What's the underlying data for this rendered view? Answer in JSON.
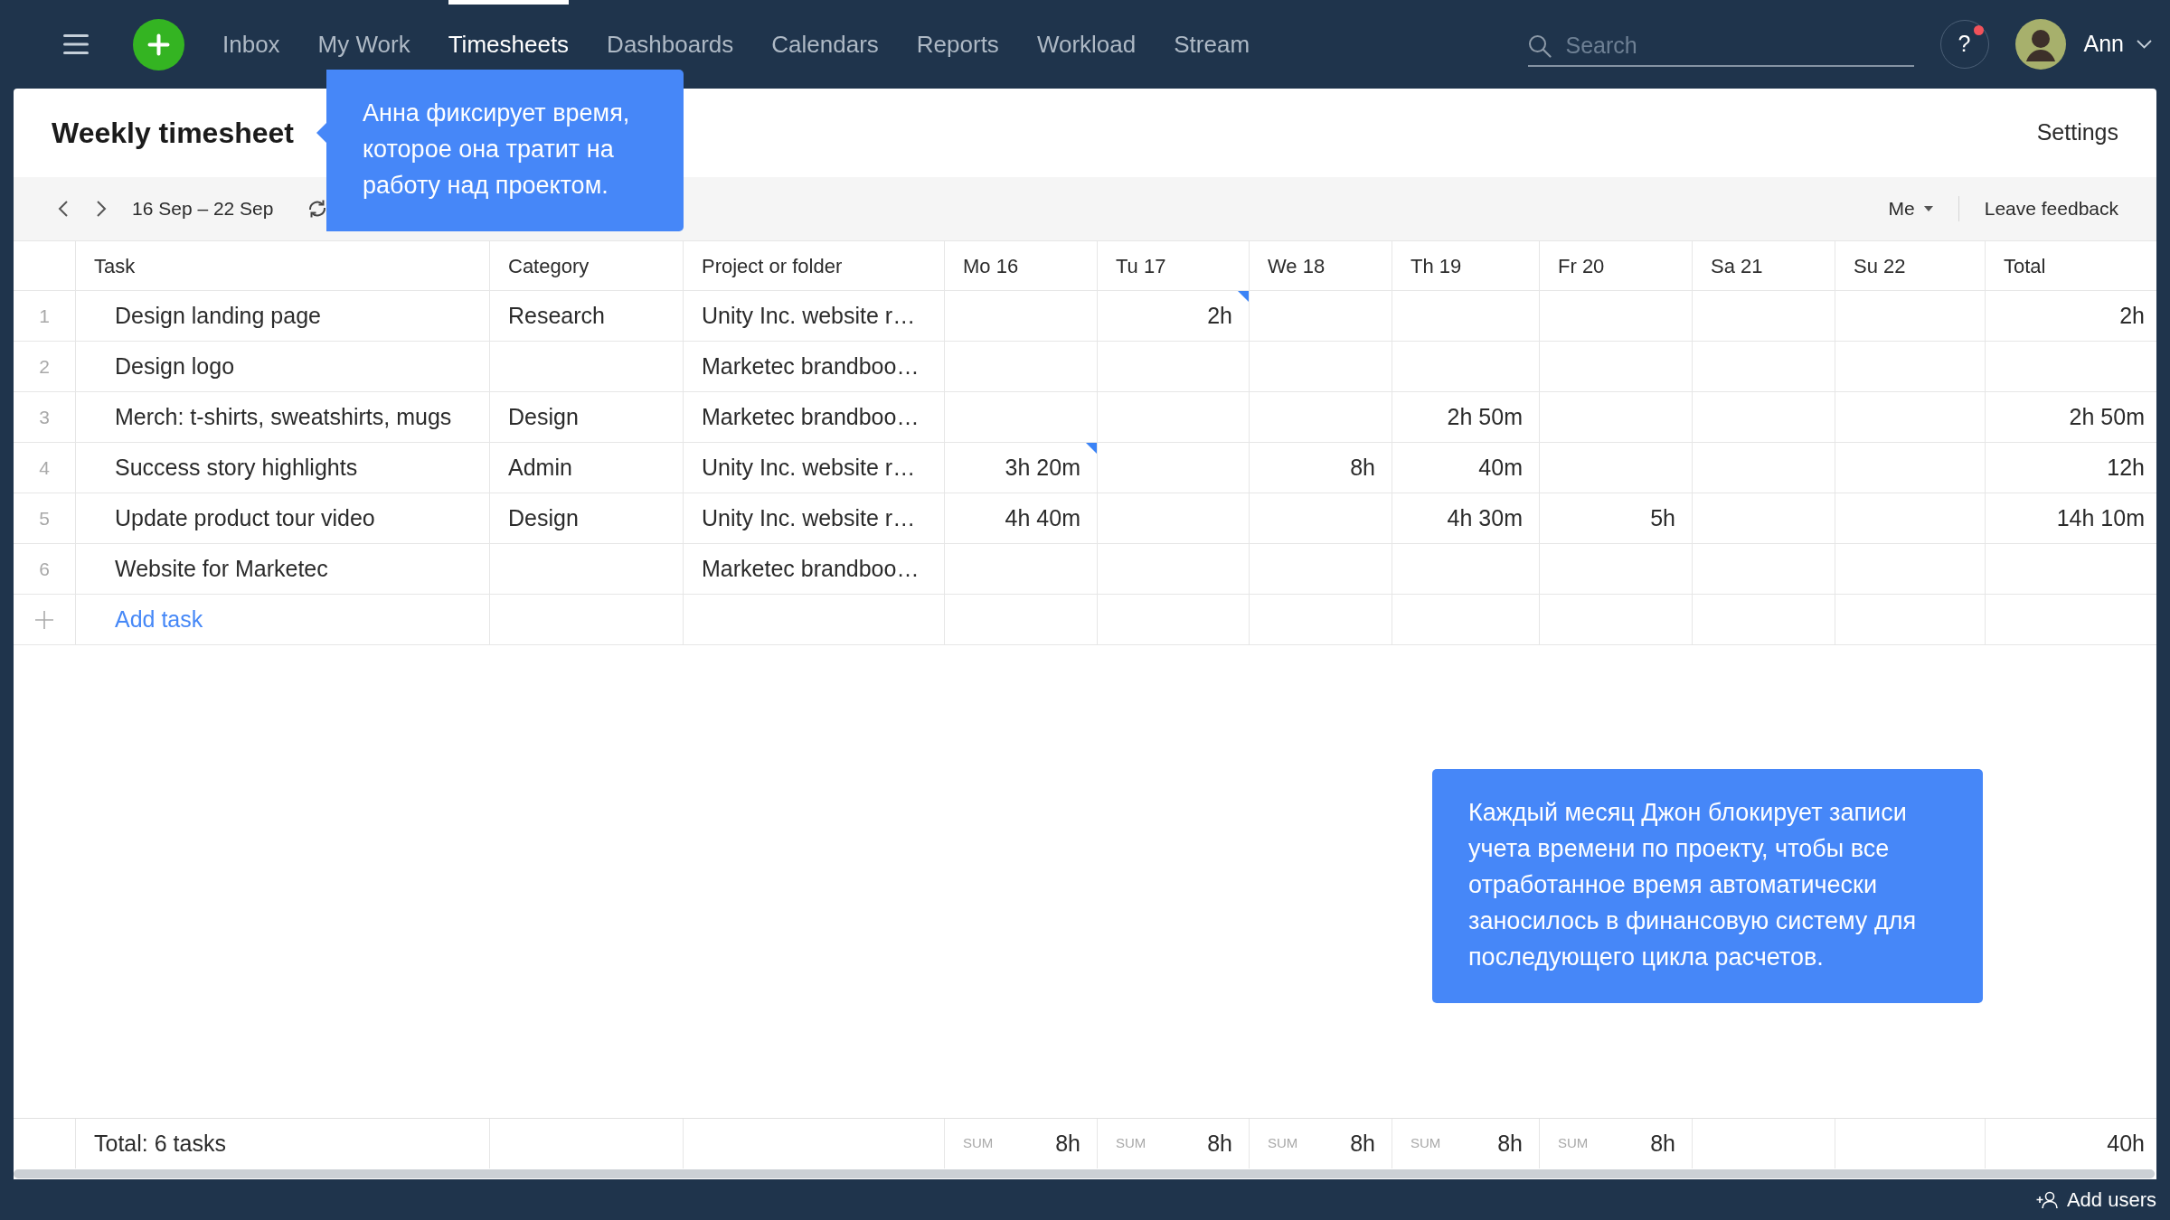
{
  "nav": {
    "tabs": [
      {
        "label": "Inbox",
        "selected": false
      },
      {
        "label": "My Work",
        "selected": false
      },
      {
        "label": "Timesheets",
        "selected": true
      },
      {
        "label": "Dashboards",
        "selected": false
      },
      {
        "label": "Calendars",
        "selected": false
      },
      {
        "label": "Reports",
        "selected": false
      },
      {
        "label": "Workload",
        "selected": false
      },
      {
        "label": "Stream",
        "selected": false
      }
    ],
    "search": {
      "placeholder": "Search"
    },
    "help": {
      "label": "?",
      "notification": true
    },
    "user": {
      "name": "Ann"
    }
  },
  "page": {
    "title": "Weekly timesheet",
    "settings": "Settings"
  },
  "toolbar": {
    "date_range": "16 Sep – 22 Sep",
    "filter": "Me",
    "feedback": "Leave feedback"
  },
  "table": {
    "columns": [
      "Task",
      "Category",
      "Project or folder",
      "Mo 16",
      "Tu 17",
      "We 18",
      "Th 19",
      "Fr 20",
      "Sa 21",
      "Su 22",
      "Total"
    ],
    "rows": [
      {
        "number": "1",
        "task": "Design landing page",
        "category": "Research",
        "project": "Unity Inc. website r…",
        "days": [
          {
            "flagged": false
          },
          {
            "value": "2h",
            "flagged": true
          },
          {
            "flagged": false
          },
          {
            "flagged": false
          },
          {
            "flagged": false
          },
          {
            "flagged": false
          },
          {
            "flagged": false
          }
        ],
        "total": "2h"
      },
      {
        "number": "2",
        "task": "Design logo",
        "project": "Marketec brandboo…",
        "days": [
          {
            "flagged": false
          },
          {
            "flagged": false
          },
          {
            "flagged": false
          },
          {
            "flagged": false
          },
          {
            "flagged": false
          },
          {
            "flagged": false
          },
          {
            "flagged": false
          }
        ]
      },
      {
        "number": "3",
        "task": "Merch: t-shirts, sweatshirts, mugs",
        "category": "Design",
        "project": "Marketec brandboo…",
        "days": [
          {
            "flagged": false
          },
          {
            "flagged": false
          },
          {
            "flagged": false
          },
          {
            "value": "2h 50m",
            "flagged": false
          },
          {
            "flagged": false
          },
          {
            "flagged": false
          },
          {
            "flagged": false
          }
        ],
        "total": "2h 50m"
      },
      {
        "number": "4",
        "task": "Success story highlights",
        "category": "Admin",
        "project": "Unity Inc. website r…",
        "days": [
          {
            "value": "3h 20m",
            "flagged": true
          },
          {
            "flagged": false
          },
          {
            "value": "8h",
            "flagged": false
          },
          {
            "value": "40m",
            "flagged": false
          },
          {
            "flagged": false
          },
          {
            "flagged": false
          },
          {
            "flagged": false
          }
        ],
        "total": "12h"
      },
      {
        "number": "5",
        "task": "Update product tour video",
        "category": "Design",
        "project": "Unity Inc. website r…",
        "days": [
          {
            "value": "4h 40m",
            "flagged": false
          },
          {
            "flagged": false
          },
          {
            "flagged": false
          },
          {
            "value": "4h 30m",
            "flagged": false
          },
          {
            "value": "5h",
            "flagged": false
          },
          {
            "flagged": false
          },
          {
            "flagged": false
          }
        ],
        "total": "14h 10m"
      },
      {
        "number": "6",
        "task": "Website for Marketec",
        "project": "Marketec brandboo…",
        "days": [
          {
            "flagged": false
          },
          {
            "flagged": false
          },
          {
            "flagged": false
          },
          {
            "flagged": false
          },
          {
            "flagged": false
          },
          {
            "flagged": false
          },
          {
            "flagged": false
          }
        ]
      }
    ],
    "add_row": {
      "label": "Add task"
    },
    "footer": {
      "label": "Total: 6 tasks",
      "sums": [
        {
          "label": "SUM",
          "value": "8h"
        },
        {
          "label": "SUM",
          "value": "8h"
        },
        {
          "label": "SUM",
          "value": "8h"
        },
        {
          "label": "SUM",
          "value": "8h"
        },
        {
          "label": "SUM",
          "value": "8h"
        }
      ],
      "total": "40h"
    }
  },
  "tooltips": [
    {
      "text": "Анна фиксирует время, которое она тратит на работу над проектом.",
      "pointer": true
    },
    {
      "text": "Каждый месяц Джон блокирует записи учета времени по проекту, чтобы все отработанное время автоматически заносилось в финансовую систему для последующего цикла расчетов.",
      "pointer": false
    }
  ],
  "status_bar": {
    "add_users": "Add users"
  }
}
